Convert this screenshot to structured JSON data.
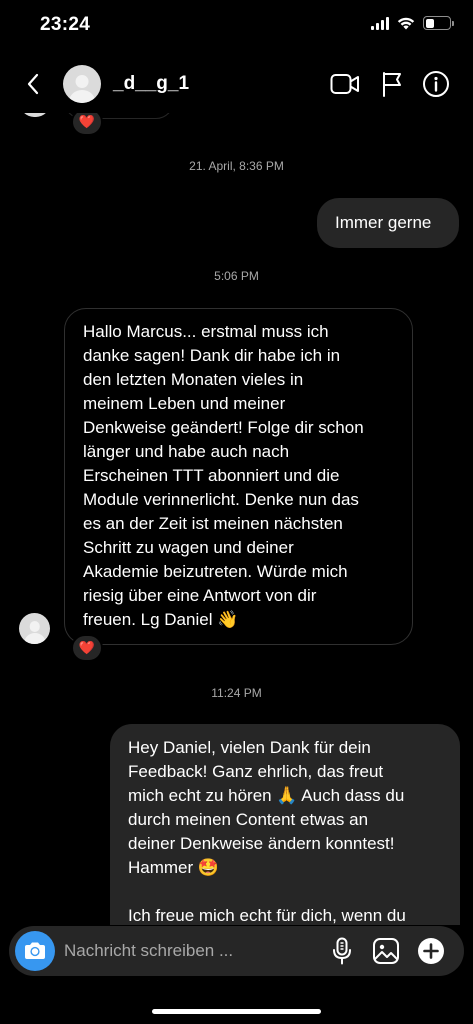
{
  "status_bar": {
    "time": "23:24",
    "battery_level": 0.35
  },
  "header": {
    "username": "_d__g_1",
    "icons": [
      "back-chevron-icon",
      "video-call-icon",
      "flag-icon",
      "info-icon"
    ]
  },
  "conversation": {
    "timestamp_1": "21. April, 8:36 PM",
    "msg_out_1": "Immer gerne",
    "timestamp_2": "5:06 PM",
    "msg_in_1_lines": [
      "Hallo Marcus... erstmal muss ich",
      "danke sagen! Dank dir habe ich in",
      "den letzten Monaten vieles in",
      "meinem Leben und meiner",
      "Denkweise geändert! Folge dir schon",
      "länger und habe auch nach",
      "Erscheinen TTT abonniert und die",
      "Module verinnerlicht. Denke nun das",
      "es an der Zeit ist meinen nächsten",
      "Schritt zu wagen und deiner",
      "Akademie beizutreten. Würde mich",
      "riesig über eine Antwort von dir",
      "freuen. Lg Daniel 👋"
    ],
    "timestamp_3": "11:24 PM",
    "msg_out_2_lines": [
      "Hey Daniel, vielen Dank für dein",
      "Feedback! Ganz ehrlich, das freut",
      "mich echt zu hören 🙏 Auch dass du",
      "durch meinen Content etwas an",
      "deiner Denkweise ändern konntest!",
      "Hammer 🤩",
      "",
      "Ich freue mich echt für dich, wenn du"
    ],
    "reaction_emoji": "❤️"
  },
  "composer": {
    "placeholder": "Nachricht schreiben ...",
    "value": ""
  },
  "colors": {
    "background": "#000000",
    "bubble_outgoing": "#262626",
    "bubble_incoming_border": "#303030",
    "camera_button": "#3797f0",
    "timestamp_text": "#a8a8a8",
    "heart": "#ed4956"
  }
}
